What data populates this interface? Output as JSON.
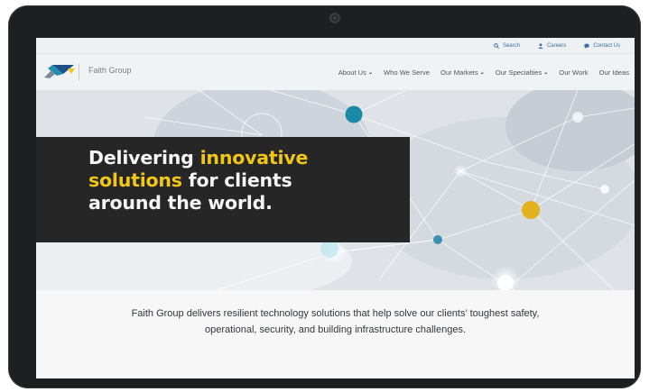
{
  "utility_links": [
    {
      "label": "Search",
      "icon": "search-icon"
    },
    {
      "label": "Careers",
      "icon": "user-icon"
    },
    {
      "label": "Contact Us",
      "icon": "chat-bubble-icon"
    }
  ],
  "brand": {
    "name": "Faith Group",
    "colors": {
      "teal": "#1f8fb0",
      "navy": "#1d4f86",
      "gold": "#f2c617",
      "gray": "#7d8a95"
    }
  },
  "nav": {
    "about": "About Us",
    "who": "Who We Serve",
    "markets": "Our Markets",
    "specialties": "Our Specialties",
    "work": "Our Work",
    "ideas": "Our Ideas"
  },
  "hero": {
    "headline_1": "Delivering ",
    "headline_accent_1": "innovative",
    "headline_accent_2": "solutions",
    "headline_2": " for clients",
    "headline_3": "around the world.",
    "accent_color": "#f2c617"
  },
  "intro": {
    "text": "Faith Group delivers resilient technology solutions that help solve our clients’ toughest safety, operational, security, and building infrastructure challenges."
  }
}
